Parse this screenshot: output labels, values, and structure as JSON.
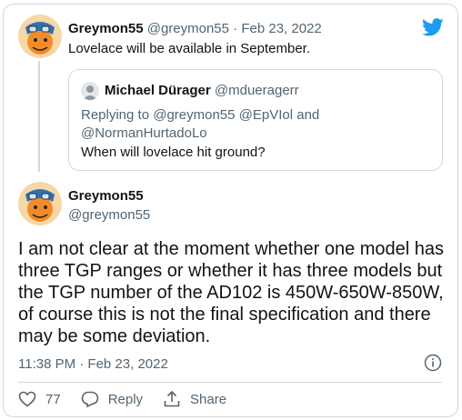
{
  "parent_tweet": {
    "display_name": "Greymon55",
    "handle": "@greymon55",
    "separator": "·",
    "date": "Feb 23, 2022",
    "text": "Lovelace will be available in September."
  },
  "quoted_tweet": {
    "display_name": "Michael Dürager",
    "handle": "@mdueragerr",
    "replying_to_line1": "Replying to @greymon55 @EpVIol and",
    "replying_to_line2": "@NormanHurtadoLo",
    "text": "When will lovelace hit ground?"
  },
  "main_tweet": {
    "display_name": "Greymon55",
    "handle": "@greymon55",
    "text": "I am not clear at the moment whether one model has three TGP ranges or whether it has three models but the TGP number of the AD102 is 450W-650W-850W, of course this is not the final specification and there may be some deviation.",
    "timestamp": "11:38 PM · Feb 23, 2022"
  },
  "actions": {
    "like_count": "77",
    "reply_label": "Reply",
    "share_label": "Share"
  },
  "icons": {
    "brand": "twitter-bird-icon",
    "info": "info-icon",
    "like": "heart-icon",
    "reply": "reply-bubble-icon",
    "share": "share-icon"
  },
  "colors": {
    "twitter_blue": "#1d9bf0",
    "text": "#0f1419",
    "muted": "#536471",
    "border": "#cfd9de"
  }
}
